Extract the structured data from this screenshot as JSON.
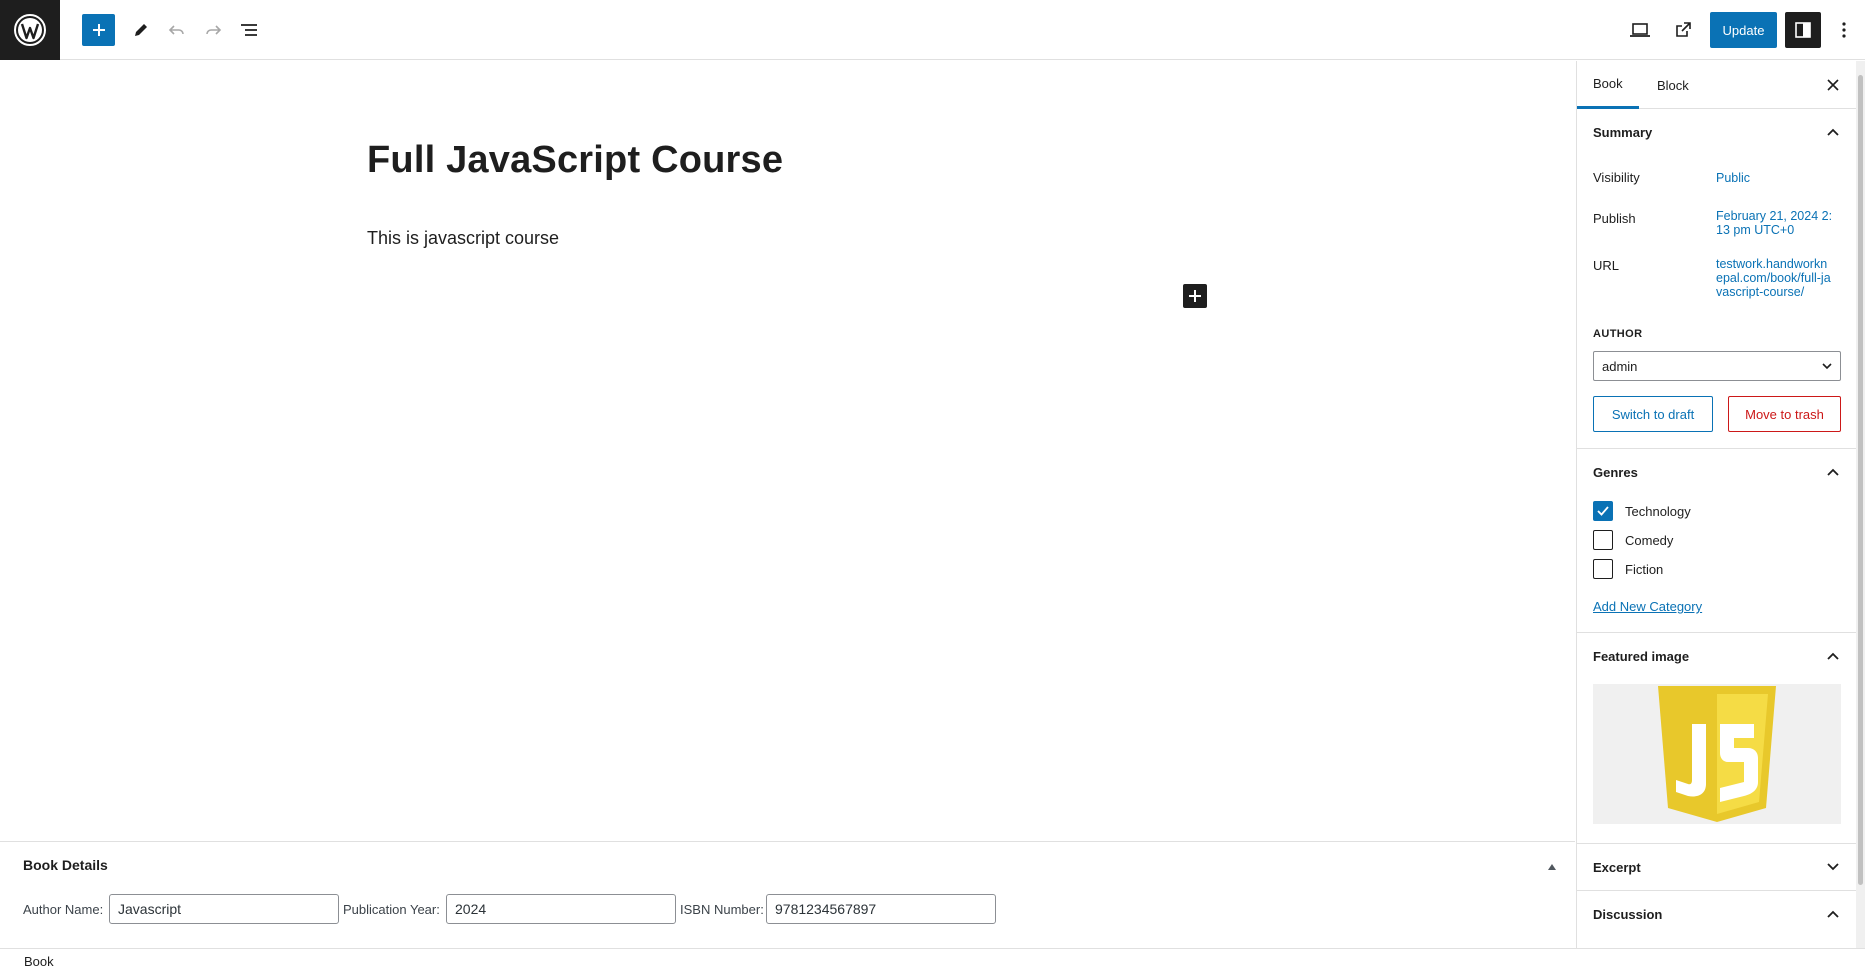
{
  "toolbar": {
    "update_label": "Update"
  },
  "editor": {
    "title": "Full JavaScript Course",
    "paragraph": "This is javascript course"
  },
  "metabox": {
    "title": "Book Details",
    "fields": [
      {
        "label": "Author Name:",
        "value": "Javascript"
      },
      {
        "label": "Publication Year:",
        "value": "2024"
      },
      {
        "label": "ISBN Number:",
        "value": "9781234567897"
      }
    ]
  },
  "footer": {
    "breadcrumb": "Book"
  },
  "sidebar": {
    "tabs": [
      {
        "label": "Book"
      },
      {
        "label": "Block"
      }
    ],
    "summary": {
      "title": "Summary",
      "visibility_label": "Visibility",
      "visibility_value": "Public",
      "publish_label": "Publish",
      "publish_value": "February 21, 2024 2:13 pm UTC+0",
      "url_label": "URL",
      "url_value": "testwork.handworknepal.com/book/full-javascript-course/",
      "author_label": "AUTHOR",
      "author_value": "admin",
      "draft_label": "Switch to draft",
      "trash_label": "Move to trash"
    },
    "genres": {
      "title": "Genres",
      "items": [
        {
          "label": "Technology",
          "checked": true
        },
        {
          "label": "Comedy",
          "checked": false
        },
        {
          "label": "Fiction",
          "checked": false
        }
      ],
      "add_label": "Add New Category"
    },
    "featured": {
      "title": "Featured image",
      "logo_text": "JS"
    },
    "excerpt": {
      "title": "Excerpt"
    },
    "discussion": {
      "title": "Discussion"
    }
  },
  "colors": {
    "accent": "#0a72b5",
    "danger": "#cc1818",
    "dark": "#1e1e1e",
    "js_yellow": "#f0db4f"
  }
}
